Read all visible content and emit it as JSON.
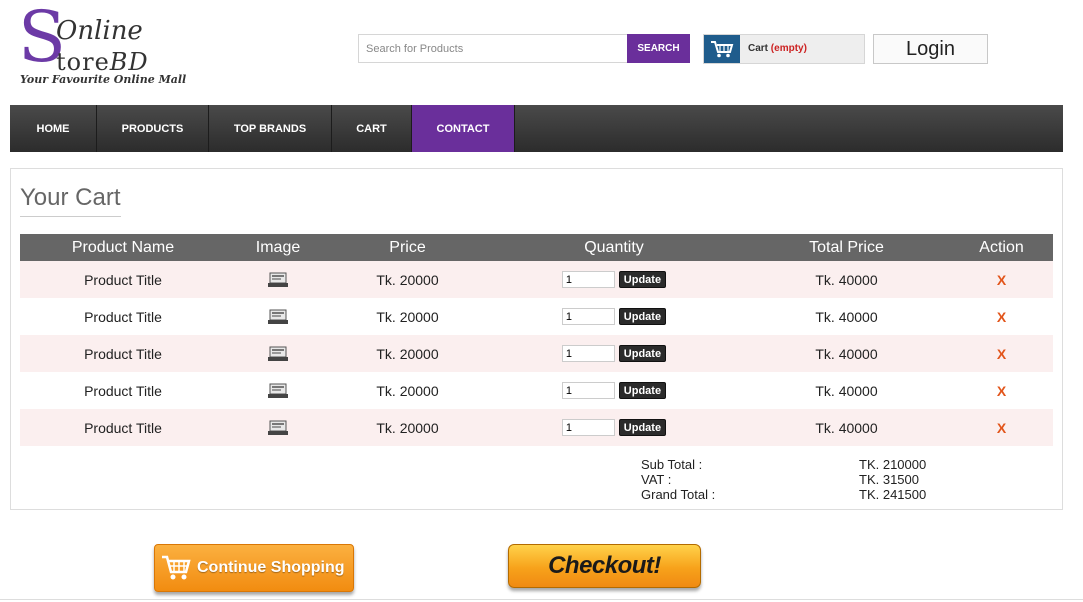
{
  "header": {
    "logo": {
      "initial": "S",
      "line1": "Online",
      "line2_main": "tore",
      "line2_suffix": "BD",
      "tagline": "Your Favourite Online Mall"
    },
    "search": {
      "placeholder": "Search for Products",
      "button_label": "SEARCH"
    },
    "cart_widget": {
      "label": "Cart",
      "status": "(empty)"
    },
    "login_label": "Login"
  },
  "nav": {
    "items": [
      {
        "label": "HOME"
      },
      {
        "label": "PRODUCTS"
      },
      {
        "label": "TOP BRANDS"
      },
      {
        "label": "CART"
      },
      {
        "label": "CONTACT"
      }
    ],
    "active": "CONTACT"
  },
  "cart": {
    "title": "Your Cart",
    "columns": [
      "Product Name",
      "Image",
      "Price",
      "Quantity",
      "Total Price",
      "Action"
    ],
    "rows": [
      {
        "name": "Product Title",
        "price": "Tk. 20000",
        "qty": "1",
        "update_label": "Update",
        "total": "Tk. 40000",
        "action": "X"
      },
      {
        "name": "Product Title",
        "price": "Tk. 20000",
        "qty": "1",
        "update_label": "Update",
        "total": "Tk. 40000",
        "action": "X"
      },
      {
        "name": "Product Title",
        "price": "Tk. 20000",
        "qty": "1",
        "update_label": "Update",
        "total": "Tk. 40000",
        "action": "X"
      },
      {
        "name": "Product Title",
        "price": "Tk. 20000",
        "qty": "1",
        "update_label": "Update",
        "total": "Tk. 40000",
        "action": "X"
      },
      {
        "name": "Product Title",
        "price": "Tk. 20000",
        "qty": "1",
        "update_label": "Update",
        "total": "Tk. 40000",
        "action": "X"
      }
    ],
    "totals": {
      "subtotal_label": "Sub Total :",
      "subtotal_value": "TK. 210000",
      "vat_label": "VAT :",
      "vat_value": "TK. 31500",
      "grand_label": "Grand Total :",
      "grand_value": "TK. 241500"
    }
  },
  "actions": {
    "continue_label": "Continue Shopping",
    "checkout_label": "Checkout!"
  },
  "colors": {
    "brand_purple": "#6a2f9b",
    "nav_dark": "#3a3a3a",
    "row_tint": "#fbefef",
    "delete_orange": "#e2551b"
  }
}
